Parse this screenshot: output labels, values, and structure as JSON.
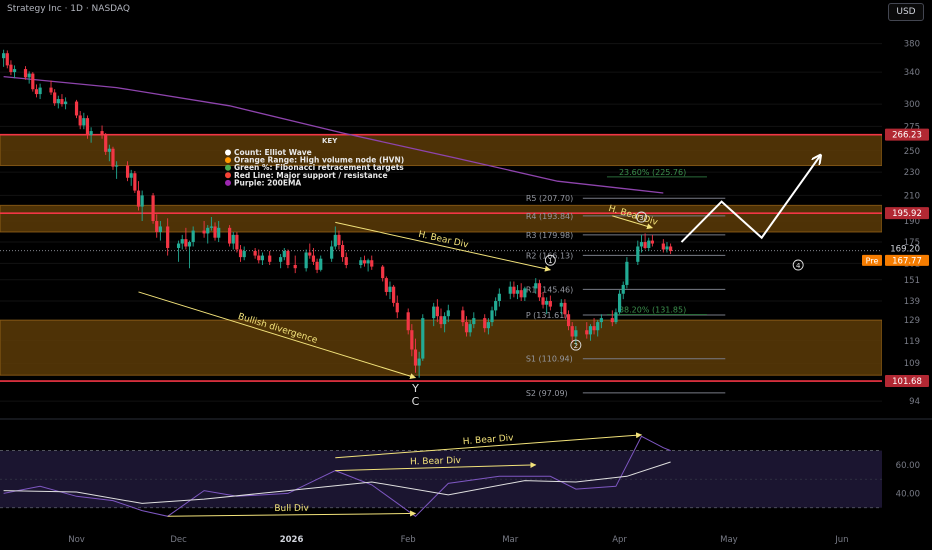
{
  "header": {
    "title": "Strategy Inc · 1D · NASDAQ",
    "currency": "USD"
  },
  "colors": {
    "bg": "#000000",
    "up": "#22ab94",
    "down": "#f23645",
    "zone": "#5c3b07",
    "zone_border": "#b7791f",
    "resistance": "#f23645",
    "ema": "#8e44ad",
    "pivot_line": "#787b86",
    "annotation": "#f2e27a",
    "rsi": "#7e57c2",
    "rsi_ma": "#e0e0e0",
    "rsi_band": "#1b1530",
    "price_tag_red": "#b22833",
    "pre_tag": "#f57c00"
  },
  "chart_data": {
    "type": "candlestick",
    "title": "Strategy Inc · 1D · NASDAQ",
    "price_axis": {
      "scale": "log",
      "ticks": [
        380,
        340,
        300,
        275,
        250,
        230,
        210,
        190,
        175,
        161,
        151,
        139,
        129,
        119,
        109,
        94
      ],
      "range": [
        88,
        420
      ]
    },
    "time_axis": {
      "labels": [
        "Nov",
        "Dec",
        "2026",
        "Feb",
        "Mar",
        "Apr",
        "May",
        "Jun"
      ],
      "range": [
        "2025-10-13",
        "2026-06-12"
      ]
    },
    "candles": [
      [
        "2025-10-14",
        359,
        371,
        347,
        366
      ],
      [
        "2025-10-15",
        366,
        370,
        345,
        349
      ],
      [
        "2025-10-16",
        350,
        356,
        336,
        340
      ],
      [
        "2025-10-17",
        340,
        349,
        332,
        344
      ],
      [
        "2025-10-20",
        344,
        348,
        330,
        333
      ],
      [
        "2025-10-21",
        333,
        341,
        325,
        338
      ],
      [
        "2025-10-22",
        338,
        340,
        315,
        318
      ],
      [
        "2025-10-23",
        318,
        324,
        308,
        312
      ],
      [
        "2025-10-24",
        312,
        325,
        306,
        320
      ],
      [
        "2025-10-27",
        320,
        329,
        311,
        314
      ],
      [
        "2025-10-28",
        314,
        318,
        298,
        301
      ],
      [
        "2025-10-29",
        301,
        310,
        295,
        306
      ],
      [
        "2025-10-30",
        306,
        312,
        297,
        300
      ],
      [
        "2025-10-31",
        300,
        308,
        294,
        303
      ],
      [
        "2025-11-03",
        303,
        305,
        284,
        287
      ],
      [
        "2025-11-04",
        287,
        292,
        272,
        276
      ],
      [
        "2025-11-05",
        276,
        290,
        272,
        284
      ],
      [
        "2025-11-06",
        284,
        287,
        262,
        266
      ],
      [
        "2025-11-07",
        266,
        274,
        258,
        270
      ],
      [
        "2025-11-10",
        270,
        276,
        262,
        266
      ],
      [
        "2025-11-11",
        266,
        268,
        246,
        249
      ],
      [
        "2025-11-12",
        249,
        256,
        240,
        252
      ],
      [
        "2025-11-13",
        252,
        254,
        232,
        235
      ],
      [
        "2025-11-14",
        235,
        240,
        224,
        236
      ],
      [
        "2025-11-17",
        236,
        240,
        222,
        225
      ],
      [
        "2025-11-18",
        225,
        232,
        218,
        229
      ],
      [
        "2025-11-19",
        229,
        231,
        212,
        214
      ],
      [
        "2025-11-20",
        214,
        222,
        198,
        201
      ],
      [
        "2025-11-21",
        201,
        214,
        190,
        210
      ],
      [
        "2025-11-24",
        210,
        212,
        188,
        190
      ],
      [
        "2025-11-25",
        190,
        195,
        178,
        182
      ],
      [
        "2025-11-26",
        182,
        190,
        176,
        186
      ],
      [
        "2025-11-28",
        186,
        192,
        166,
        171
      ],
      [
        "2025-12-01",
        171,
        176,
        162,
        174
      ],
      [
        "2025-12-02",
        174,
        180,
        170,
        177
      ],
      [
        "2025-12-03",
        177,
        185,
        170,
        172
      ],
      [
        "2025-12-04",
        172,
        176,
        158,
        175
      ],
      [
        "2025-12-05",
        175,
        186,
        172,
        183
      ],
      [
        "2025-12-08",
        183,
        190,
        178,
        181
      ],
      [
        "2025-12-09",
        181,
        187,
        174,
        185
      ],
      [
        "2025-12-10",
        185,
        193,
        183,
        186
      ],
      [
        "2025-12-11",
        186,
        189,
        176,
        178
      ],
      [
        "2025-12-12",
        178,
        190,
        175,
        185
      ],
      [
        "2025-12-15",
        185,
        187,
        172,
        174
      ],
      [
        "2025-12-16",
        174,
        182,
        170,
        180
      ],
      [
        "2025-12-17",
        180,
        182,
        168,
        170
      ],
      [
        "2025-12-18",
        170,
        173,
        162,
        165
      ],
      [
        "2025-12-19",
        165,
        172,
        163,
        169
      ],
      [
        "2025-12-22",
        169,
        171,
        164,
        166
      ],
      [
        "2025-12-23",
        166,
        170,
        161,
        163
      ],
      [
        "2025-12-24",
        163,
        168,
        160,
        166
      ],
      [
        "2025-12-26",
        166,
        169,
        160,
        162
      ],
      [
        "2025-12-29",
        162,
        167,
        158,
        165
      ],
      [
        "2025-12-30",
        165,
        171,
        163,
        169
      ],
      [
        "2025-12-31",
        169,
        170,
        158,
        160
      ],
      [
        "2026-01-02",
        160,
        166,
        155,
        158
      ],
      [
        "2026-01-05",
        158,
        170,
        156,
        168
      ],
      [
        "2026-01-06",
        168,
        174,
        164,
        166
      ],
      [
        "2026-01-07",
        166,
        171,
        160,
        162
      ],
      [
        "2026-01-08",
        162,
        164,
        155,
        157
      ],
      [
        "2026-01-09",
        157,
        166,
        156,
        164
      ],
      [
        "2026-01-12",
        164,
        176,
        162,
        172
      ],
      [
        "2026-01-13",
        172,
        186,
        170,
        180
      ],
      [
        "2026-01-14",
        180,
        183,
        170,
        173
      ],
      [
        "2026-01-15",
        173,
        176,
        162,
        165
      ],
      [
        "2026-01-16",
        165,
        168,
        158,
        160
      ],
      [
        "2026-01-20",
        160,
        165,
        158,
        163
      ],
      [
        "2026-01-21",
        163,
        166,
        159,
        161
      ],
      [
        "2026-01-22",
        161,
        164,
        156,
        163
      ],
      [
        "2026-01-23",
        163,
        166,
        157,
        159
      ],
      [
        "2026-01-26",
        159,
        160,
        150,
        152
      ],
      [
        "2026-01-27",
        152,
        153,
        142,
        144
      ],
      [
        "2026-01-28",
        144,
        150,
        140,
        147
      ],
      [
        "2026-01-29",
        147,
        148,
        136,
        138
      ],
      [
        "2026-01-30",
        138,
        142,
        130,
        133
      ],
      [
        "2026-02-02",
        133,
        135,
        122,
        124
      ],
      [
        "2026-02-03",
        124,
        127,
        112,
        115
      ],
      [
        "2026-02-04",
        115,
        120,
        105,
        108
      ],
      [
        "2026-02-05",
        108,
        114,
        103,
        111
      ],
      [
        "2026-02-06",
        111,
        132,
        110,
        130
      ],
      [
        "2026-02-09",
        130,
        138,
        126,
        136
      ],
      [
        "2026-02-10",
        136,
        140,
        128,
        131
      ],
      [
        "2026-02-11",
        131,
        135,
        125,
        127
      ],
      [
        "2026-02-12",
        127,
        133,
        123,
        131
      ],
      [
        "2026-02-13",
        131,
        137,
        128,
        134
      ],
      [
        "2026-02-17",
        134,
        136,
        126,
        128
      ],
      [
        "2026-02-18",
        128,
        131,
        121,
        123
      ],
      [
        "2026-02-19",
        123,
        129,
        121,
        127
      ],
      [
        "2026-02-20",
        127,
        133,
        125,
        130
      ],
      [
        "2026-02-23",
        130,
        132,
        123,
        125
      ],
      [
        "2026-02-24",
        125,
        130,
        122,
        128
      ],
      [
        "2026-02-25",
        128,
        136,
        126,
        134
      ],
      [
        "2026-02-26",
        134,
        141,
        131,
        139
      ],
      [
        "2026-02-27",
        139,
        146,
        136,
        143
      ],
      [
        "2026-03-02",
        143,
        150,
        140,
        147
      ],
      [
        "2026-03-03",
        147,
        150,
        141,
        143
      ],
      [
        "2026-03-04",
        143,
        148,
        140,
        145
      ],
      [
        "2026-03-05",
        145,
        149,
        139,
        141
      ],
      [
        "2026-03-06",
        141,
        147,
        139,
        146
      ],
      [
        "2026-03-09",
        146,
        152,
        143,
        149
      ],
      [
        "2026-03-10",
        149,
        151,
        139,
        141
      ],
      [
        "2026-03-11",
        141,
        144,
        135,
        137
      ],
      [
        "2026-03-12",
        137,
        141,
        132,
        139
      ],
      [
        "2026-03-13",
        139,
        142,
        134,
        136
      ],
      [
        "2026-03-16",
        136,
        140,
        132,
        138
      ],
      [
        "2026-03-17",
        138,
        140,
        130,
        132
      ],
      [
        "2026-03-18",
        132,
        134,
        124,
        126
      ],
      [
        "2026-03-19",
        126,
        128,
        118,
        121
      ],
      [
        "2026-03-20",
        121,
        126,
        117,
        124
      ],
      [
        "2026-03-23",
        124,
        128,
        120,
        122
      ],
      [
        "2026-03-24",
        122,
        127,
        119,
        126
      ],
      [
        "2026-03-25",
        126,
        130,
        122,
        124
      ],
      [
        "2026-03-26",
        124,
        129,
        121,
        128
      ],
      [
        "2026-03-27",
        128,
        132,
        125,
        130
      ],
      [
        "2026-03-30",
        130,
        134,
        126,
        128
      ],
      [
        "2026-03-31",
        128,
        135,
        127,
        133
      ],
      [
        "2026-04-01",
        133,
        145,
        132,
        143
      ],
      [
        "2026-04-02",
        143,
        150,
        140,
        148
      ],
      [
        "2026-04-03",
        148,
        165,
        146,
        162
      ],
      [
        "2026-04-06",
        162,
        176,
        160,
        172
      ],
      [
        "2026-04-07",
        172,
        180,
        168,
        175
      ],
      [
        "2026-04-08",
        175,
        181,
        170,
        171
      ],
      [
        "2026-04-09",
        171,
        178,
        169,
        176
      ],
      [
        "2026-04-10",
        176,
        180,
        172,
        174
      ],
      [
        "2026-04-13",
        174,
        177,
        168,
        170
      ],
      [
        "2026-04-14",
        170,
        175,
        168,
        172
      ],
      [
        "2026-04-15",
        172,
        174,
        167,
        169
      ]
    ],
    "ema200": {
      "name": "Purple: 200EMA",
      "points": [
        [
          "2025-10-14",
          334
        ],
        [
          "2025-11-14",
          320
        ],
        [
          "2025-12-15",
          298
        ],
        [
          "2026-01-15",
          268
        ],
        [
          "2026-02-15",
          243
        ],
        [
          "2026-03-15",
          222
        ],
        [
          "2026-04-13",
          212
        ]
      ]
    },
    "zones": [
      {
        "low": 236,
        "high": 266
      },
      {
        "low": 182,
        "high": 202
      },
      {
        "low": 104,
        "high": 129
      }
    ],
    "resistance_levels": [
      {
        "value": 266.23,
        "label": "266.23"
      },
      {
        "value": 195.92,
        "label": "195.92"
      },
      {
        "value": 101.68,
        "label": "101.68"
      }
    ],
    "current_price_tags": [
      {
        "value": 169.2,
        "label": "169.20"
      },
      {
        "value": 167.77,
        "label": "167.77",
        "prefix": "Pre"
      }
    ],
    "pivots": [
      {
        "label": "R5 (207.70)",
        "value": 207.7
      },
      {
        "label": "R4 (193.84)",
        "value": 193.84
      },
      {
        "label": "R3 (179.98)",
        "value": 179.98
      },
      {
        "label": "R2 (166.13)",
        "value": 166.13
      },
      {
        "label": "R1 (145.46)",
        "value": 145.46
      },
      {
        "label": "P (131.61)",
        "value": 131.61
      },
      {
        "label": "S1 (110.94)",
        "value": 110.94
      },
      {
        "label": "S2 (97.09)",
        "value": 97.09
      }
    ],
    "fibs": [
      {
        "label": "23.60% (225.76)",
        "value": 225.76
      },
      {
        "label": "38.20% (131.85)",
        "value": 131.85
      }
    ],
    "annotations": [
      {
        "text": "H. Bear Div",
        "from": [
          "2026-01-13",
          189
        ],
        "to": [
          "2026-03-13",
          157
        ]
      },
      {
        "text": "H. Bear Div",
        "from": [
          "2026-03-30",
          193.84
        ],
        "to": [
          "2026-04-10",
          185
        ]
      },
      {
        "text": "Bullish divergence",
        "from": [
          "2025-11-20",
          144
        ],
        "to": [
          "2026-02-04",
          103
        ]
      }
    ],
    "wave_labels": [
      {
        "text": "1",
        "date": "2026-03-13",
        "value": 163,
        "circled": true
      },
      {
        "text": "2",
        "date": "2026-03-20",
        "value": 117,
        "circled": true
      },
      {
        "text": "3",
        "date": "2026-04-07",
        "value": 193,
        "circled": true
      },
      {
        "text": "4",
        "date": "2026-05-20",
        "value": 160,
        "circled": true
      },
      {
        "text": "Y",
        "date": "2026-02-04",
        "value": 99,
        "circled": false
      },
      {
        "text": "C",
        "date": "2026-02-04",
        "value": 94,
        "circled": false
      }
    ],
    "projection": {
      "points": [
        [
          "2026-04-18",
          175
        ],
        [
          "2026-04-29",
          205
        ],
        [
          "2026-05-10",
          178
        ],
        [
          "2026-05-26",
          245
        ]
      ]
    },
    "legend": {
      "title": "KEY",
      "position": "center-top",
      "items": [
        {
          "label": "Count: Elliot Wave",
          "color": "#ffffff"
        },
        {
          "label": "Orange Range: High volume node (HVN)",
          "color": "#ff9800"
        },
        {
          "label": "Green %: Fibonacci retracement targets",
          "color": "#4caf50"
        },
        {
          "label": "Red Line: Major support / resistance",
          "color": "#f44336"
        },
        {
          "label": "Purple: 200EMA",
          "color": "#9c27b0"
        }
      ]
    },
    "rsi": {
      "range": [
        20,
        90
      ],
      "ticks": [
        60,
        40
      ],
      "bands": [
        30,
        70
      ],
      "series": {
        "name": "RSI",
        "points": [
          [
            "2025-10-14",
            40
          ],
          [
            "2025-10-24",
            45
          ],
          [
            "2025-11-03",
            38
          ],
          [
            "2025-11-13",
            35
          ],
          [
            "2025-11-21",
            28
          ],
          [
            "2025-11-28",
            24
          ],
          [
            "2025-12-08",
            42
          ],
          [
            "2025-12-17",
            38
          ],
          [
            "2025-12-31",
            40
          ],
          [
            "2026-01-13",
            56
          ],
          [
            "2026-01-23",
            46
          ],
          [
            "2026-02-04",
            24
          ],
          [
            "2026-02-13",
            47
          ],
          [
            "2026-02-27",
            52
          ],
          [
            "2026-03-13",
            52
          ],
          [
            "2026-03-20",
            43
          ],
          [
            "2026-03-31",
            45
          ],
          [
            "2026-04-07",
            80
          ],
          [
            "2026-04-13",
            72
          ],
          [
            "2026-04-15",
            70
          ]
        ]
      },
      "ma": {
        "points": [
          [
            "2025-10-14",
            42
          ],
          [
            "2025-11-03",
            41
          ],
          [
            "2025-11-21",
            33
          ],
          [
            "2025-12-08",
            36
          ],
          [
            "2025-12-31",
            42
          ],
          [
            "2026-01-23",
            48
          ],
          [
            "2026-02-13",
            39
          ],
          [
            "2026-03-06",
            49
          ],
          [
            "2026-03-20",
            48
          ],
          [
            "2026-04-03",
            52
          ],
          [
            "2026-04-15",
            62
          ]
        ]
      },
      "annotations": [
        {
          "text": "H. Bear Div",
          "from": [
            "2026-01-13",
            65
          ],
          "to": [
            "2026-04-07",
            81
          ]
        },
        {
          "text": "H. Bear Div",
          "from": [
            "2026-01-13",
            56
          ],
          "to": [
            "2026-03-09",
            60
          ]
        },
        {
          "text": "Bull Div",
          "from": [
            "2025-11-28",
            24
          ],
          "to": [
            "2026-02-04",
            26
          ]
        }
      ]
    }
  }
}
